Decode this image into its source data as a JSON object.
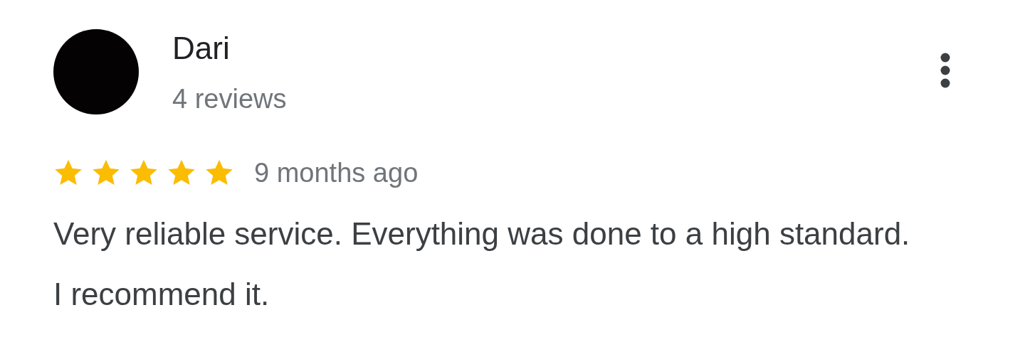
{
  "reviewer": {
    "name": "Dari",
    "review_count": "4 reviews"
  },
  "review": {
    "stars": 5,
    "time": "9 months ago",
    "text": "Very reliable service. Everything was done to a high standard. I recommend it."
  }
}
